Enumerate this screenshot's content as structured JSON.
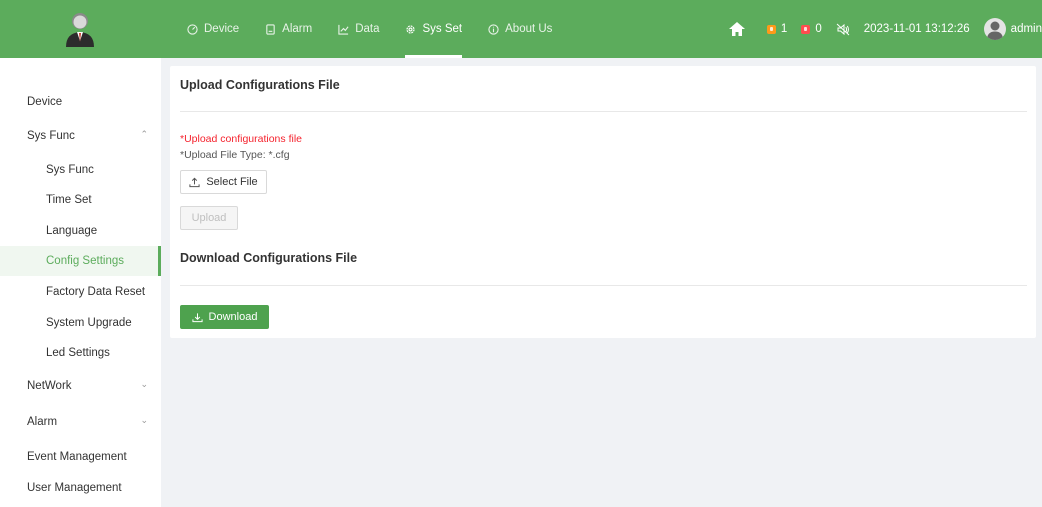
{
  "header": {
    "nav": [
      {
        "label": "Device",
        "icon": "dashboard-icon"
      },
      {
        "label": "Alarm",
        "icon": "alarm-icon"
      },
      {
        "label": "Data",
        "icon": "line-chart-icon"
      },
      {
        "label": "Sys Set",
        "icon": "gear-icon"
      },
      {
        "label": "About Us",
        "icon": "info-icon"
      }
    ],
    "active_nav": "Sys Set",
    "alarm_count_orange": "1",
    "alarm_count_red": "0",
    "datetime": "2023-11-01 13:12:26",
    "user": "admin"
  },
  "sidebar": {
    "items": [
      {
        "label": "Device"
      },
      {
        "label": "Sys Func"
      },
      {
        "label": "Sys Func"
      },
      {
        "label": "Time Set"
      },
      {
        "label": "Language"
      },
      {
        "label": "Config Settings"
      },
      {
        "label": "Factory Data Reset"
      },
      {
        "label": "System Upgrade"
      },
      {
        "label": "Led Settings"
      },
      {
        "label": "NetWork"
      },
      {
        "label": "Alarm"
      },
      {
        "label": "Event Management"
      },
      {
        "label": "User Management"
      }
    ],
    "active_item": "Config Settings"
  },
  "main": {
    "upload": {
      "title": "Upload Configurations File",
      "required_label": "*Upload configurations file",
      "file_type_hint": "*Upload File Type: *.cfg",
      "select_button": "Select File",
      "upload_button": "Upload"
    },
    "download": {
      "title": "Download Configurations File",
      "download_button": "Download"
    }
  },
  "colors": {
    "brand": "#5cac5c",
    "primary_button": "#4ea24e",
    "required": "#f5222d"
  }
}
